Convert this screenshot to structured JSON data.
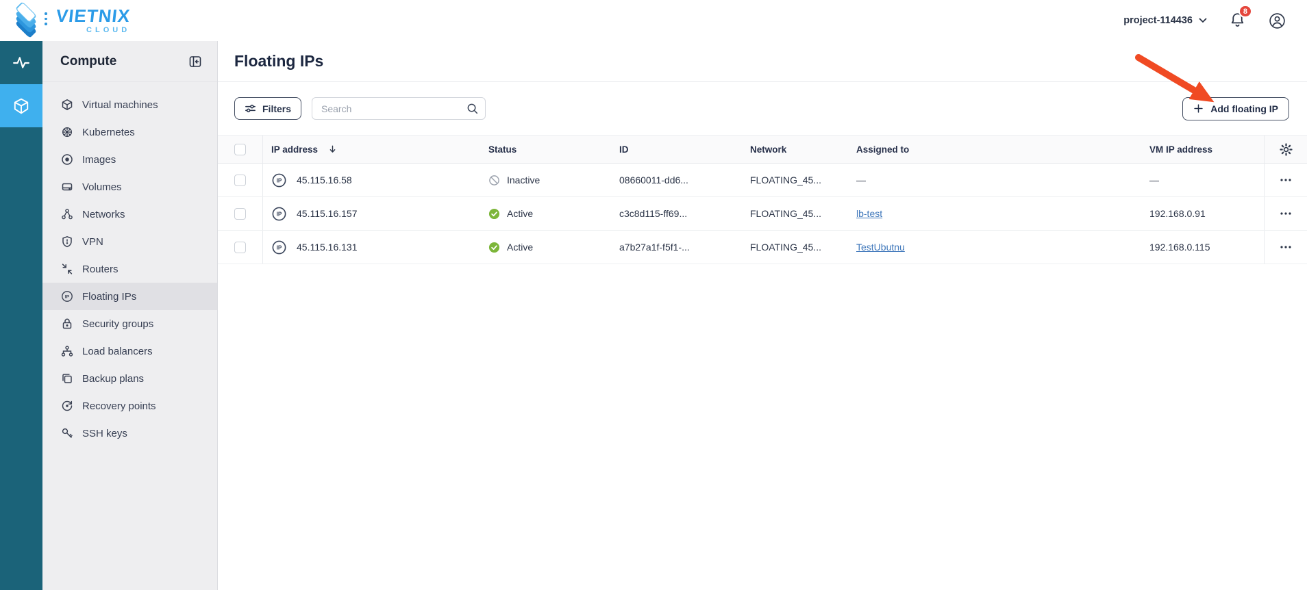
{
  "brand": {
    "name": "VIETNIX",
    "tagline": "CLOUD"
  },
  "header": {
    "project_selector": "project-114436",
    "notification_badge": "8"
  },
  "sidebar": {
    "title": "Compute",
    "items": [
      {
        "label": "Virtual machines",
        "icon": "cube-icon"
      },
      {
        "label": "Kubernetes",
        "icon": "kubernetes-wheel-icon"
      },
      {
        "label": "Images",
        "icon": "disc-icon"
      },
      {
        "label": "Volumes",
        "icon": "drive-icon"
      },
      {
        "label": "Networks",
        "icon": "network-nodes-icon"
      },
      {
        "label": "VPN",
        "icon": "shield-icon"
      },
      {
        "label": "Routers",
        "icon": "routes-icon"
      },
      {
        "label": "Floating IPs",
        "icon": "ip-circle-icon",
        "active": true
      },
      {
        "label": "Security groups",
        "icon": "padlock-icon"
      },
      {
        "label": "Load balancers",
        "icon": "hierarchy-icon"
      },
      {
        "label": "Backup plans",
        "icon": "copy-icon"
      },
      {
        "label": "Recovery points",
        "icon": "restore-icon"
      },
      {
        "label": "SSH keys",
        "icon": "key-icon"
      }
    ]
  },
  "page": {
    "title": "Floating IPs"
  },
  "toolbar": {
    "filters_label": "Filters",
    "search_placeholder": "Search",
    "add_button_label": "Add floating IP"
  },
  "table": {
    "columns": {
      "ip": "IP address",
      "status": "Status",
      "id": "ID",
      "network": "Network",
      "assigned": "Assigned to",
      "vm_ip": "VM IP address"
    },
    "rows": [
      {
        "ip": "45.115.16.58",
        "status": "Inactive",
        "id": "08660011-dd6...",
        "network": "FLOATING_45...",
        "assigned_to": "—",
        "vm_ip": "—"
      },
      {
        "ip": "45.115.16.157",
        "status": "Active",
        "id": "c3c8d115-ff69...",
        "network": "FLOATING_45...",
        "assigned_to": "lb-test",
        "vm_ip": "192.168.0.91"
      },
      {
        "ip": "45.115.16.131",
        "status": "Active",
        "id": "a7b27a1f-f5f1-...",
        "network": "FLOATING_45...",
        "assigned_to": "TestUbutnu",
        "vm_ip": "192.168.0.115"
      }
    ]
  },
  "colors": {
    "rail": "#1b6379",
    "rail_active": "#3fb0ee",
    "brand_blue": "#2b9be8",
    "active_green": "#7db63a",
    "inactive_gray": "#9ba1ac",
    "link_blue": "#3d76ba",
    "badge_red": "#e5463c",
    "annotation_arrow_red": "#f04a23"
  }
}
